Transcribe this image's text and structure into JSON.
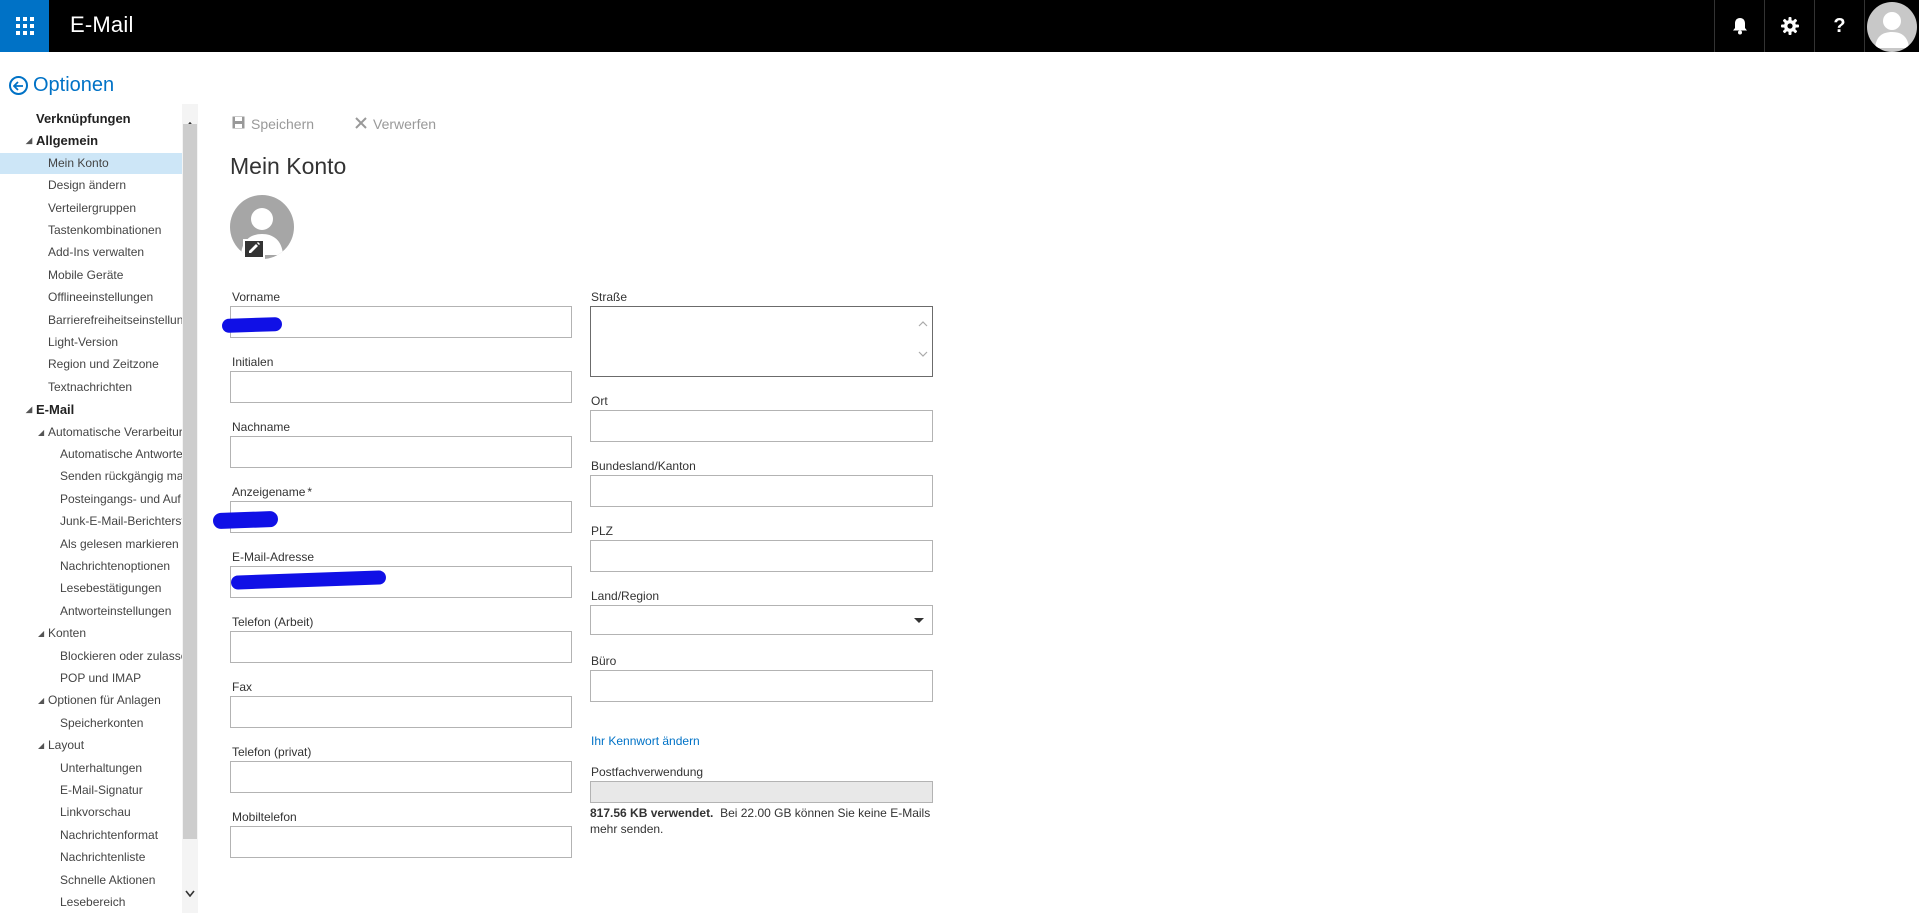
{
  "topbar": {
    "app_title": "E-Mail",
    "icons": [
      "app-launcher-icon",
      "bell-icon",
      "gear-icon",
      "help-icon",
      "user-avatar"
    ]
  },
  "header": {
    "back_label": "Optionen"
  },
  "sidebar": {
    "items": [
      {
        "label": "Verknüpfungen",
        "level": 0,
        "bold": true
      },
      {
        "label": "Allgemein",
        "level": 0,
        "bold": true,
        "expanded": true
      },
      {
        "label": "Mein Konto",
        "level": 1,
        "selected": true
      },
      {
        "label": "Design ändern",
        "level": 1
      },
      {
        "label": "Verteilergruppen",
        "level": 1
      },
      {
        "label": "Tastenkombinationen",
        "level": 1
      },
      {
        "label": "Add-Ins verwalten",
        "level": 1
      },
      {
        "label": "Mobile Geräte",
        "level": 1
      },
      {
        "label": "Offlineeinstellungen",
        "level": 1
      },
      {
        "label": "Barrierefreiheitseinstellun",
        "level": 1
      },
      {
        "label": "Light-Version",
        "level": 1
      },
      {
        "label": "Region und Zeitzone",
        "level": 1
      },
      {
        "label": "Textnachrichten",
        "level": 1
      },
      {
        "label": "E-Mail",
        "level": 0,
        "bold": true,
        "expanded": true
      },
      {
        "label": "Automatische Verarbeitur",
        "level": 1,
        "expanded": true
      },
      {
        "label": "Automatische Antworte",
        "level": 2
      },
      {
        "label": "Senden rückgängig ma",
        "level": 2
      },
      {
        "label": "Posteingangs- und Auf",
        "level": 2
      },
      {
        "label": "Junk-E-Mail-Berichterst",
        "level": 2
      },
      {
        "label": "Als gelesen markieren",
        "level": 2
      },
      {
        "label": "Nachrichtenoptionen",
        "level": 2
      },
      {
        "label": "Lesebestätigungen",
        "level": 2
      },
      {
        "label": "Antworteinstellungen",
        "level": 2
      },
      {
        "label": "Konten",
        "level": 1,
        "expanded": true
      },
      {
        "label": "Blockieren oder zulasse",
        "level": 2
      },
      {
        "label": "POP und IMAP",
        "level": 2
      },
      {
        "label": "Optionen für Anlagen",
        "level": 1,
        "expanded": true
      },
      {
        "label": "Speicherkonten",
        "level": 2
      },
      {
        "label": "Layout",
        "level": 1,
        "expanded": true
      },
      {
        "label": "Unterhaltungen",
        "level": 2
      },
      {
        "label": "E-Mail-Signatur",
        "level": 2
      },
      {
        "label": "Linkvorschau",
        "level": 2
      },
      {
        "label": "Nachrichtenformat",
        "level": 2
      },
      {
        "label": "Nachrichtenliste",
        "level": 2
      },
      {
        "label": "Schnelle Aktionen",
        "level": 2
      },
      {
        "label": "Lesebereich",
        "level": 2
      }
    ]
  },
  "toolbar": {
    "save_label": "Speichern",
    "discard_label": "Verwerfen"
  },
  "page": {
    "title": "Mein Konto"
  },
  "form": {
    "left": [
      {
        "label": "Vorname",
        "value": "",
        "redacted": true
      },
      {
        "label": "Initialen",
        "value": ""
      },
      {
        "label": "Nachname",
        "value": ""
      },
      {
        "label": "Anzeigename",
        "required_mark": "*",
        "value": "",
        "redacted": true
      },
      {
        "label": "E-Mail-Adresse",
        "value": "",
        "redacted": true
      },
      {
        "label": "Telefon (Arbeit)",
        "value": ""
      },
      {
        "label": "Fax",
        "value": ""
      },
      {
        "label": "Telefon (privat)",
        "value": ""
      },
      {
        "label": "Mobiltelefon",
        "value": ""
      }
    ],
    "right": {
      "street_label": "Straße",
      "city_label": "Ort",
      "state_label": "Bundesland/Kanton",
      "zip_label": "PLZ",
      "country_label": "Land/Region",
      "country_value": "",
      "office_label": "Büro"
    },
    "password_link": "Ihr Kennwort ändern",
    "mailbox": {
      "label": "Postfachverwendung",
      "used_text": "817.56 KB verwendet.",
      "limit_text": "Bei 22.00 GB können Sie keine E-Mails mehr senden.",
      "usage_fraction": 0.0
    }
  },
  "colors": {
    "accent": "#0072c6",
    "topbar": "#000000",
    "selected_nav": "#cde6f7"
  }
}
